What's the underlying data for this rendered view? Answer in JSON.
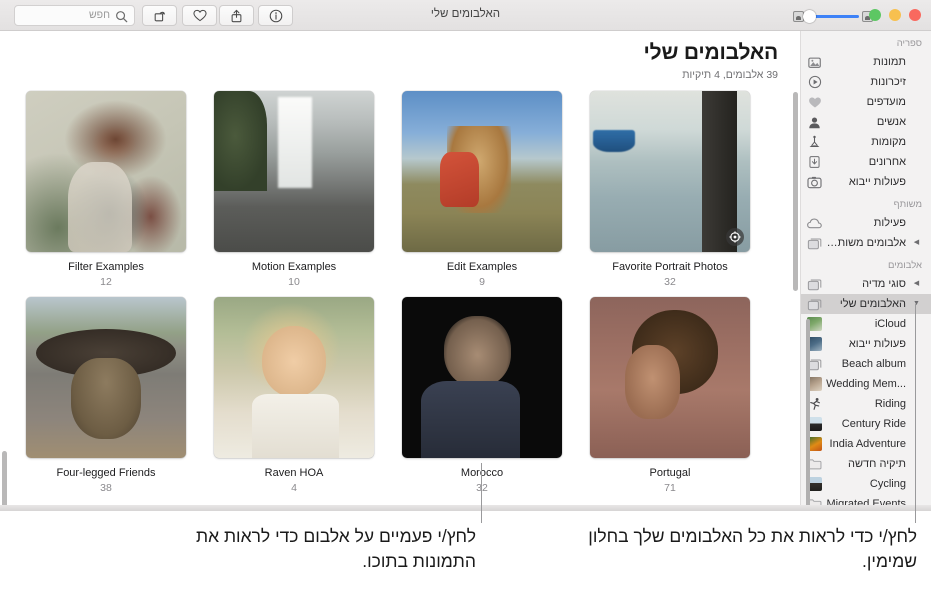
{
  "window": {
    "title": "האלבומים שלי"
  },
  "toolbar": {
    "search_placeholder": "חפש",
    "search_value": "",
    "buttons": [
      {
        "name": "rotate-button",
        "icon": "rotate-icon"
      },
      {
        "name": "favorite-button",
        "icon": "heart-icon"
      },
      {
        "name": "share-button",
        "icon": "share-icon"
      },
      {
        "name": "info-button",
        "icon": "info-icon"
      }
    ],
    "zoom_slider": {
      "value": 18,
      "min_icon": "small-thumbnail-icon",
      "max_icon": "large-thumbnail-icon"
    },
    "traffic_lights": {
      "close": "#f9695f",
      "minimize": "#f7c04f",
      "zoom": "#5dc763"
    }
  },
  "content": {
    "title": "האלבומים שלי",
    "subtitle": "39 אלבומים, 4 תיקיות"
  },
  "albums": [
    {
      "name": "Filter Examples",
      "count": "12",
      "art": "ph-tattoo",
      "smart": false
    },
    {
      "name": "Motion Examples",
      "count": "10",
      "art": "ph-waterfall",
      "smart": false
    },
    {
      "name": "Edit Examples",
      "count": "9",
      "art": "ph-field",
      "smart": false
    },
    {
      "name": "Favorite Portrait Photos",
      "count": "32",
      "art": "ph-harbor",
      "smart": true
    },
    {
      "name": "Four-legged Friends",
      "count": "38",
      "art": "ph-dog",
      "smart": false
    },
    {
      "name": "Raven HOA",
      "count": "4",
      "art": "ph-blonde",
      "smart": false
    },
    {
      "name": "Morocco",
      "count": "32",
      "art": "ph-man",
      "smart": false
    },
    {
      "name": "Portugal",
      "count": "71",
      "art": "ph-curly",
      "smart": false
    }
  ],
  "sidebar": {
    "sections": [
      {
        "title": "ספריה",
        "items": [
          {
            "label": "תמונות",
            "icon": "photos-icon",
            "kind": "glyph"
          },
          {
            "label": "זיכרונות",
            "icon": "memories-icon",
            "kind": "glyph"
          },
          {
            "label": "מועדפים",
            "icon": "heart-icon",
            "kind": "glyph"
          },
          {
            "label": "אנשים",
            "icon": "person-icon",
            "kind": "glyph"
          },
          {
            "label": "מקומות",
            "icon": "places-pin-icon",
            "kind": "glyph"
          },
          {
            "label": "אחרונים",
            "icon": "recents-icon",
            "kind": "glyph"
          },
          {
            "label": "פעולות ייבוא",
            "icon": "import-camera-icon",
            "kind": "glyph"
          }
        ]
      },
      {
        "title": "משותף",
        "items": [
          {
            "label": "פעילות",
            "icon": "cloud-icon",
            "kind": "glyph"
          },
          {
            "label": "אלבומים משותפים",
            "icon": "shared-album-icon",
            "kind": "glyph",
            "disclosure": "collapsed"
          }
        ]
      },
      {
        "title": "אלבומים",
        "items": [
          {
            "label": "סוגי מדיה",
            "icon": "album-stack-icon",
            "kind": "glyph",
            "disclosure": "collapsed"
          },
          {
            "label": "האלבומים שלי",
            "icon": "album-stack-icon",
            "kind": "glyph",
            "disclosure": "expanded",
            "selected": true
          },
          {
            "label": "iCloud",
            "icon": "album-thumb",
            "kind": "thumb",
            "thumb": "t-icloud",
            "indent": true
          },
          {
            "label": "פעולות ייבוא",
            "icon": "album-thumb",
            "kind": "thumb",
            "thumb": "t-import",
            "indent": true
          },
          {
            "label": "Beach album",
            "icon": "album-stack-icon",
            "kind": "glyph",
            "indent": true
          },
          {
            "label": "...Wedding Mem",
            "icon": "album-thumb",
            "kind": "thumb",
            "thumb": "t-wedding",
            "indent": true
          },
          {
            "label": "Riding",
            "icon": "riding-icon",
            "kind": "glyph",
            "indent": true
          },
          {
            "label": "Century Ride",
            "icon": "album-thumb",
            "kind": "thumb",
            "thumb": "t-century",
            "indent": true
          },
          {
            "label": "India Adventure",
            "icon": "album-thumb",
            "kind": "thumb",
            "thumb": "t-india",
            "indent": true
          },
          {
            "label": "תיקיה חדשה",
            "icon": "folder-icon",
            "kind": "glyph",
            "indent": true
          },
          {
            "label": "Cycling",
            "icon": "album-thumb",
            "kind": "thumb",
            "thumb": "t-cycling",
            "indent": true
          },
          {
            "label": "Migrated Events",
            "icon": "folder-icon",
            "kind": "glyph",
            "indent": true
          }
        ]
      }
    ]
  },
  "callouts": {
    "left": "לחץ/י פעמיים על אלבום כדי לראות את התמונות בתוכו.",
    "right": "לחץ/י כדי לראות את כל האלבומים שלך בחלון שמימין."
  }
}
